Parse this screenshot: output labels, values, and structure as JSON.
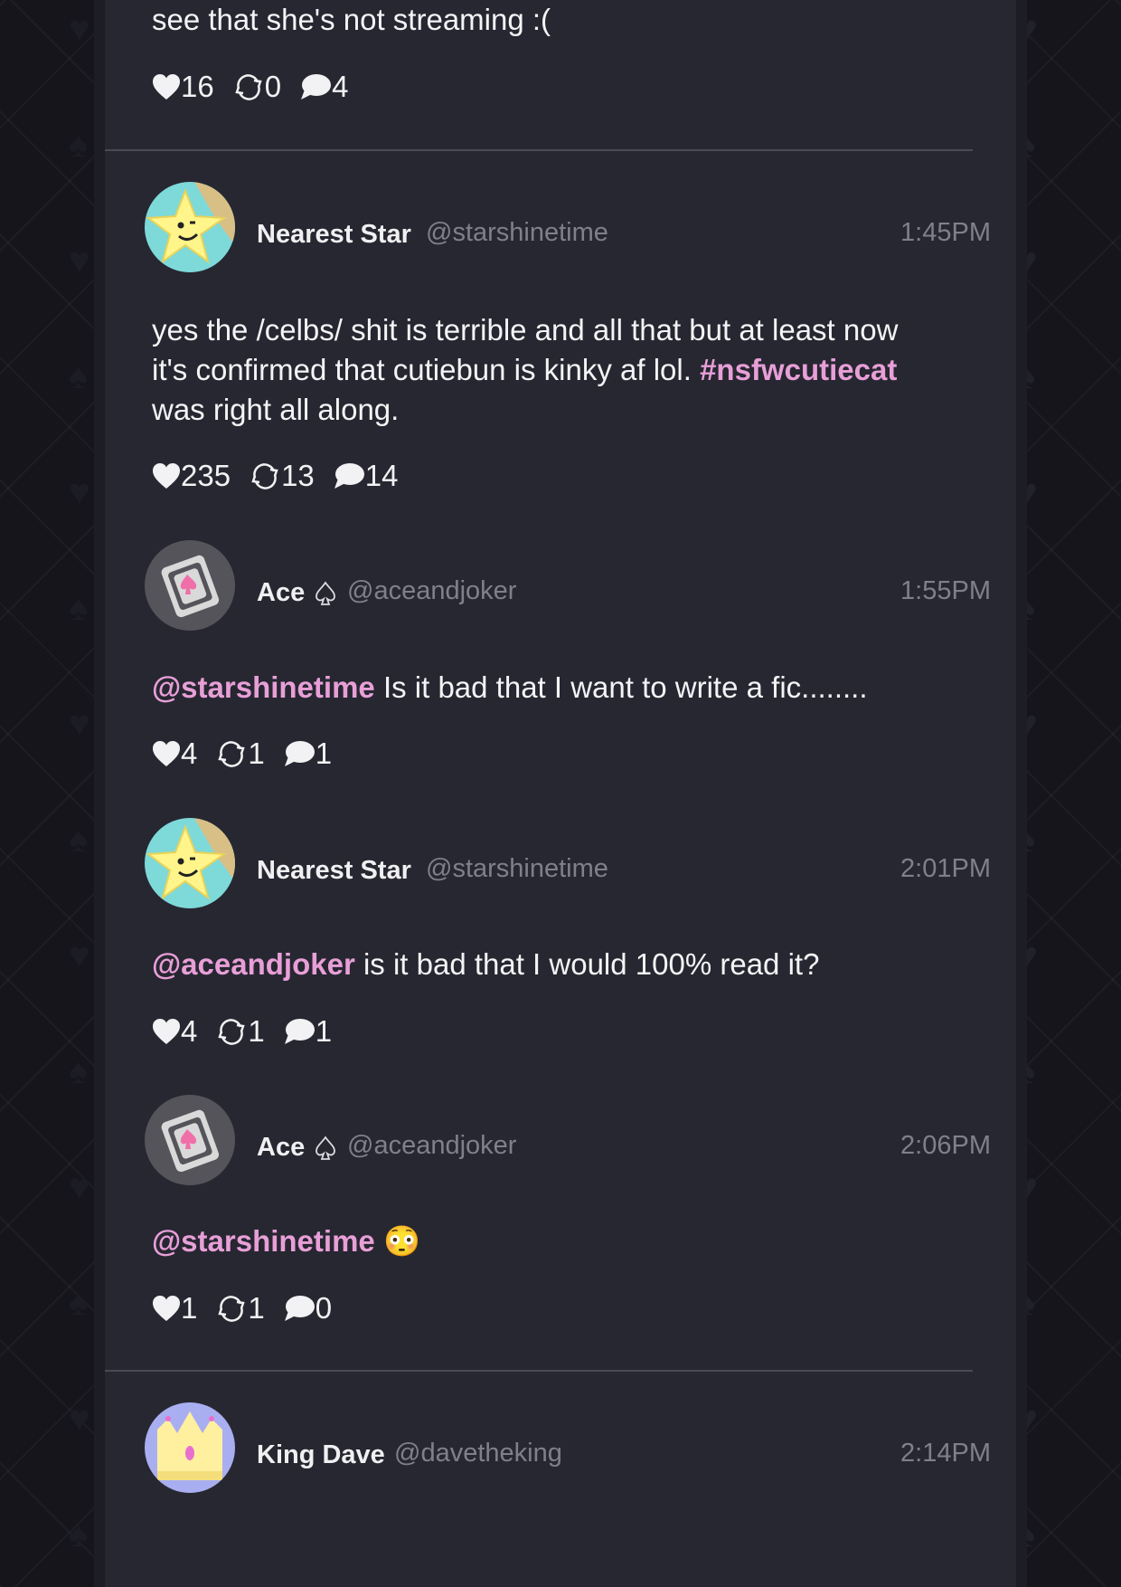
{
  "colors": {
    "background": "#15151b",
    "panel": "#272731",
    "text": "#f4f4f6",
    "muted": "#80808c",
    "accent_pink": "#e89fd8",
    "divider": "#4a4a55"
  },
  "icons": {
    "like": "heart-icon",
    "reblog": "repost-icon",
    "reply": "comment-icon",
    "badge": "spade-icon"
  },
  "posts": [
    {
      "text": "see that she's not streaming :(",
      "likes": "16",
      "reposts": "0",
      "replies": "4"
    },
    {
      "name": "Nearest Star",
      "handle": "@starshinetime",
      "time": "1:45PM",
      "text_1": "yes the /celbs/ shit is terrible and all that but at least now",
      "text_2": "it's confirmed that cutiebun is kinky af lol.",
      "hashtag": "#nsfwcutiecat",
      "text_3": "was right all along.",
      "likes": "235",
      "reposts": "13",
      "replies": "14"
    },
    {
      "name": "Ace",
      "handle": "@aceandjoker",
      "time": "1:55PM",
      "mention": "@starshinetime",
      "text": "Is it bad that I want to write a fic........",
      "likes": "4",
      "reposts": "1",
      "replies": "1"
    },
    {
      "name": "Nearest Star",
      "handle": "@starshinetime",
      "time": "2:01PM",
      "mention": "@aceandjoker",
      "text": "is it bad that I would 100% read it?",
      "likes": "4",
      "reposts": "1",
      "replies": "1"
    },
    {
      "name": "Ace",
      "handle": "@aceandjoker",
      "time": "2:06PM",
      "mention": "@starshinetime",
      "emoji": "😳",
      "likes": "1",
      "reposts": "1",
      "replies": "0"
    },
    {
      "name": "King Dave",
      "handle": "@davetheking",
      "time": "2:14PM"
    }
  ]
}
